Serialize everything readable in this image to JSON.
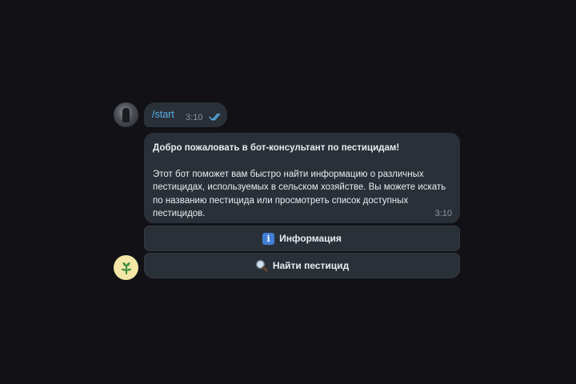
{
  "outgoing": {
    "command": "/start",
    "time": "3:10",
    "status": "read-double-check"
  },
  "bot_message": {
    "title": "Добро пожаловать в бот-консультант по пестицидам!",
    "body": "Этот бот поможет вам быстро найти информацию о различных пестицидах, используемых в сельском хозяйстве. Вы можете искать по названию пестицида или просмотреть список доступных пестицидов.",
    "time": "3:10"
  },
  "keyboard": {
    "buttons": [
      {
        "icon": "info-icon",
        "label": "Информация"
      },
      {
        "icon": "magnifier-icon",
        "label": "Найти пестицид"
      }
    ]
  },
  "colors": {
    "background": "#111116",
    "bubble": "#2a3038",
    "link": "#5ab0ee",
    "bot_avatar": "#f3e6a6",
    "bot_avatar_leaf": "#2e8b3a"
  }
}
